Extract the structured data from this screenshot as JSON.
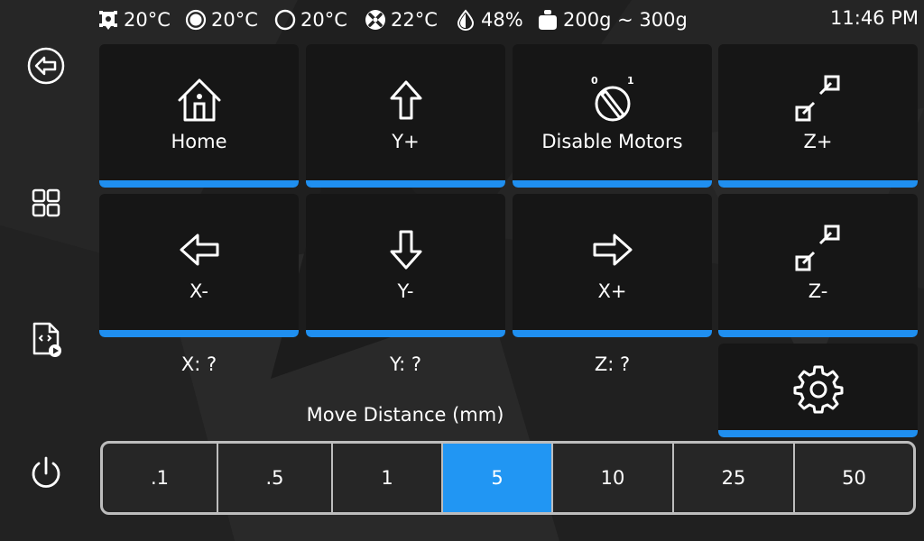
{
  "theme": {
    "accent": "#1f8ff0",
    "selected": "#2196f3",
    "tile_bg": "#161616",
    "page_bg": "#232323"
  },
  "status": {
    "extruder_temp": "20°C",
    "bed_temp": "20°C",
    "chamber_temp": "20°C",
    "fan_temp": "22°C",
    "humidity": "48%",
    "filament_weight": "200g ~ 300g",
    "time": "11:46 PM",
    "icons": [
      "extruder-icon",
      "heater-bed-icon",
      "heater-generic-icon",
      "fan-icon",
      "humidity-icon",
      "spool-weight-icon"
    ]
  },
  "sidebar": {
    "items": [
      "back-icon",
      "grid-icon",
      "gcode-file-icon",
      "power-icon"
    ]
  },
  "tiles": {
    "home": "Home",
    "y_plus": "Y+",
    "disable_motors": "Disable Motors",
    "disable_motors_marks": [
      "0",
      "1"
    ],
    "z_plus": "Z+",
    "x_minus": "X-",
    "y_minus": "Y-",
    "x_plus": "X+",
    "z_minus": "Z-",
    "settings_icon": "gear-icon"
  },
  "positions": {
    "x": "X: ?",
    "y": "Y: ?",
    "z": "Z: ?"
  },
  "move_distance": {
    "title": "Move Distance (mm)",
    "options": [
      ".1",
      ".5",
      "1",
      "5",
      "10",
      "25",
      "50"
    ],
    "selected": "5"
  }
}
